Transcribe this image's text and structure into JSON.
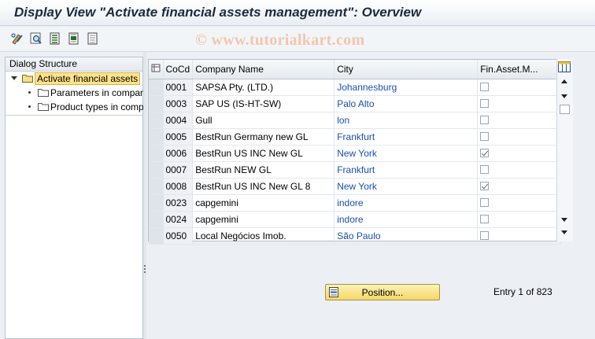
{
  "window": {
    "title": "Display View \"Activate financial assets management\": Overview",
    "watermark": "© www.tutorialkart.com"
  },
  "toolbar": {
    "buttons": [
      "display-change-icon",
      "find-icon",
      "select-all-icon",
      "select-block-icon",
      "deselect-all-icon"
    ]
  },
  "dialog_structure": {
    "header": "Dialog Structure",
    "items": [
      {
        "label": "Activate financial assets",
        "level": 0,
        "selected": true
      },
      {
        "label": "Parameters in company code",
        "level": 1,
        "selected": false
      },
      {
        "label": "Product types in company code",
        "level": 1,
        "selected": false
      }
    ]
  },
  "table": {
    "columns": [
      "CoCd",
      "Company Name",
      "City",
      "Fin.Asset.M..."
    ],
    "rows": [
      {
        "cocd": "0001",
        "name": "SAPSA Pty. (LTD.)",
        "city": "Johannesburg",
        "checked": false
      },
      {
        "cocd": "0003",
        "name": "SAP US (IS-HT-SW)",
        "city": "Palo Alto",
        "checked": false
      },
      {
        "cocd": "0004",
        "name": "Gull",
        "city": "lon",
        "checked": false
      },
      {
        "cocd": "0005",
        "name": "BestRun Germany new GL",
        "city": "Frankfurt",
        "checked": false
      },
      {
        "cocd": "0006",
        "name": "BestRun US INC New GL",
        "city": "New York",
        "checked": true
      },
      {
        "cocd": "0007",
        "name": "BestRun NEW GL",
        "city": "Frankfurt",
        "checked": false
      },
      {
        "cocd": "0008",
        "name": "BestRun US INC New GL 8",
        "city": "New York",
        "checked": true
      },
      {
        "cocd": "0023",
        "name": "capgemini",
        "city": "indore",
        "checked": false
      },
      {
        "cocd": "0024",
        "name": "capgemini",
        "city": "indore",
        "checked": false
      },
      {
        "cocd": "0050",
        "name": "Local Negócios Imob.",
        "city": "São Paulo",
        "checked": false
      }
    ]
  },
  "footer": {
    "position_button": "Position...",
    "entry_text": "Entry 1 of 823"
  },
  "colors": {
    "link_city": "#1b4fb0",
    "selected_tree": "#ffe38a",
    "position_button": "#f5d768"
  }
}
